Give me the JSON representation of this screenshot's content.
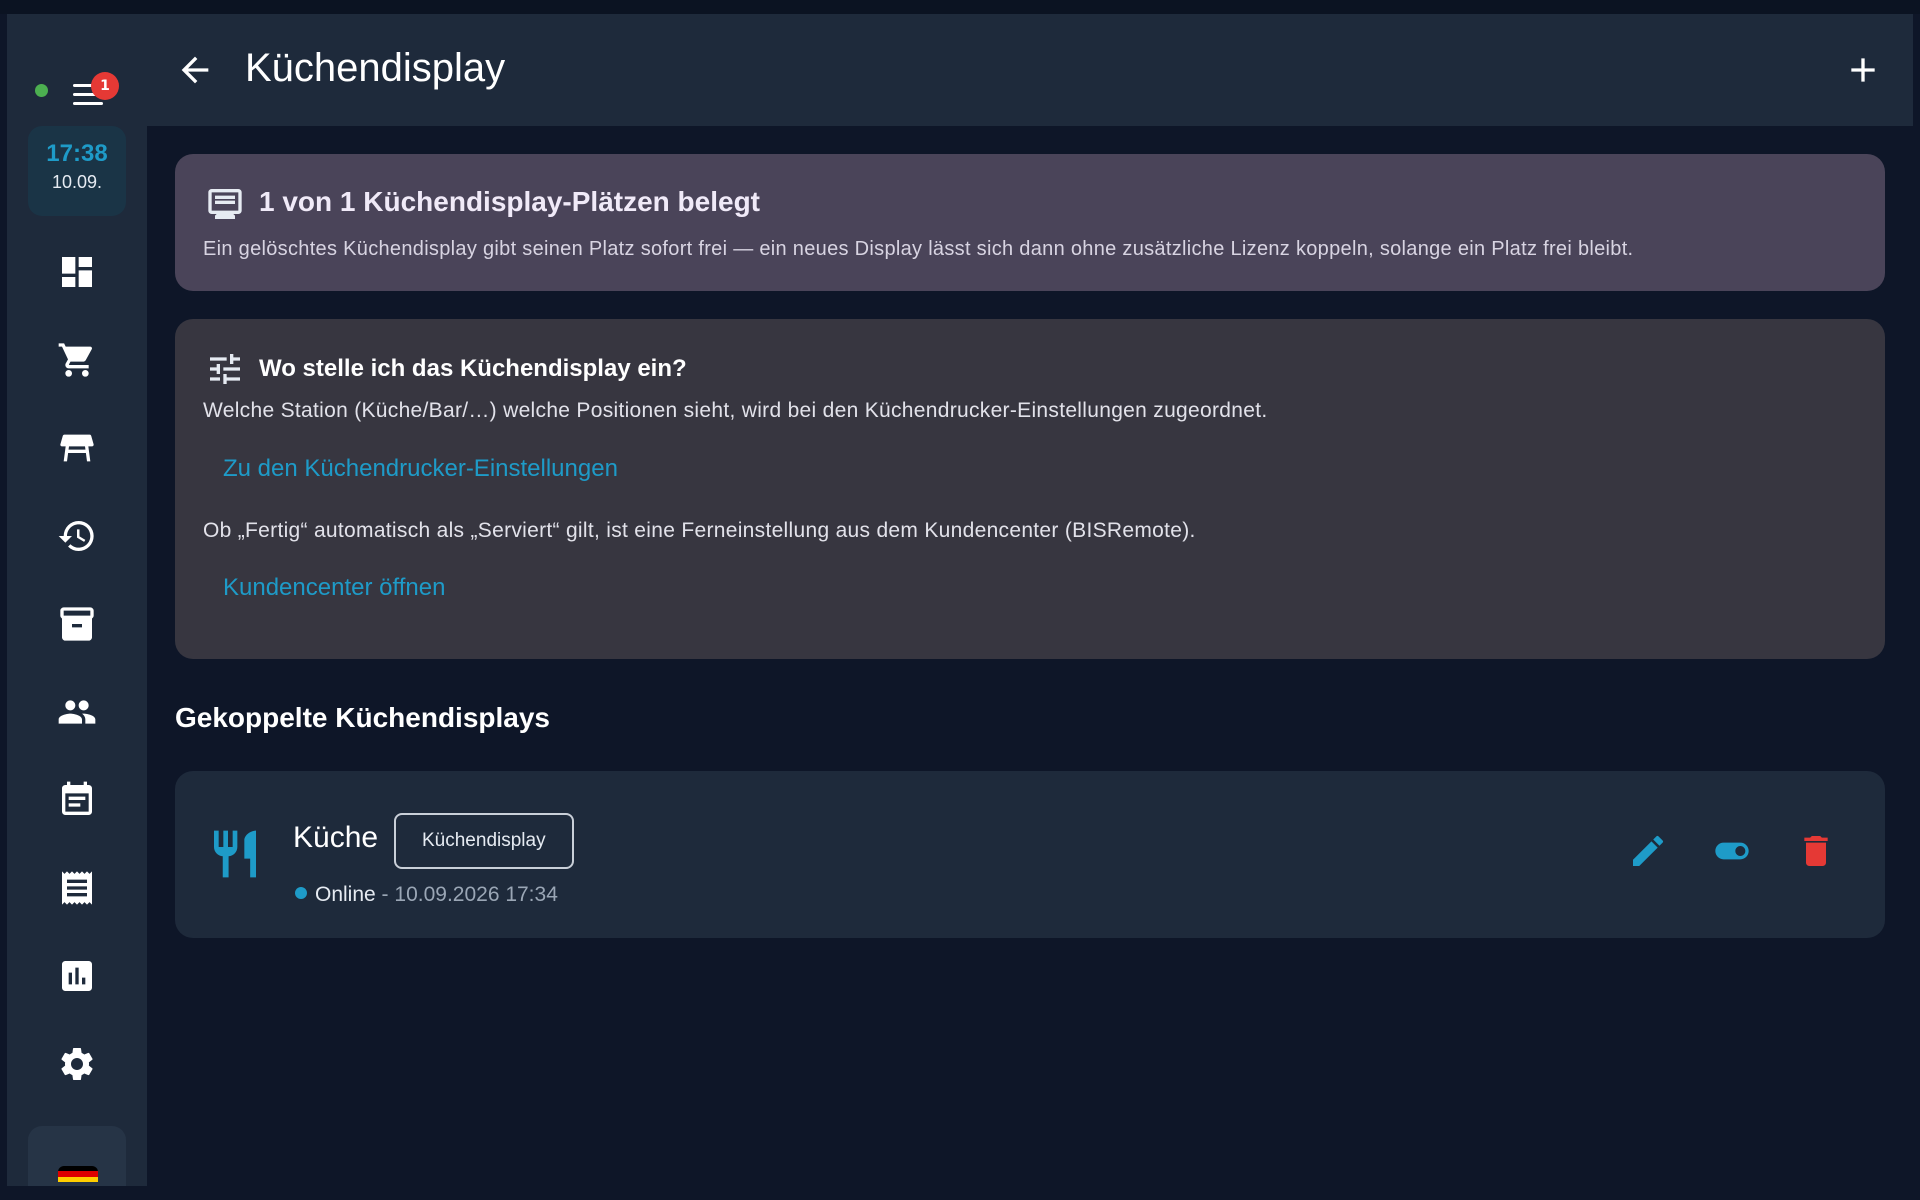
{
  "sidebar": {
    "notification_count": "1",
    "clock": {
      "time": "17:38",
      "date": "10.09."
    },
    "nav_icons": [
      "dashboard-icon",
      "cart-icon",
      "table-icon",
      "history-icon",
      "archive-icon",
      "people-icon",
      "calendar-icon",
      "receipt-icon",
      "chart-icon",
      "settings-icon"
    ],
    "flag_colors": [
      "#000000",
      "#dd0000",
      "#ffce00"
    ]
  },
  "header": {
    "title": "Küchendisplay",
    "back_icon": "arrow-back-icon",
    "add_icon": "plus-icon"
  },
  "license": {
    "icon": "kds-icon",
    "title": "1 von 1 Küchendisplay-Plätzen belegt",
    "description": "Ein gelöschtes Küchendisplay gibt seinen Platz sofort frei — ein neues Display lässt sich dann ohne zusätzliche Lizenz koppeln, solange ein Platz frei bleibt."
  },
  "help": {
    "icon": "tune-icon",
    "title": "Wo stelle ich das Küchendisplay ein?",
    "text1": "Welche Station (Küche/Bar/…) welche Positionen sieht, wird bei den Küchendrucker-Einstellungen zugeordnet.",
    "link1": "Zu den Küchendrucker-Einstellungen",
    "text2": "Ob „Fertig“ automatisch als „Serviert“ gilt, ist eine Ferneinstellung aus dem Kundencenter (BISRemote).",
    "link2": "Kundencenter öffnen"
  },
  "section_title": "Gekoppelte Küchendisplays",
  "devices": [
    {
      "icon": "restaurant-icon",
      "name": "Küche",
      "type_chip": "Küchendisplay",
      "status": "Online",
      "separator": "-",
      "last_seen": "10.09.2026 17:34",
      "actions": [
        "edit-icon",
        "toggle-icon",
        "delete-icon"
      ]
    }
  ],
  "colors": {
    "accent": "#1e9bc8",
    "danger": "#e53935",
    "online": "#4caf50"
  }
}
